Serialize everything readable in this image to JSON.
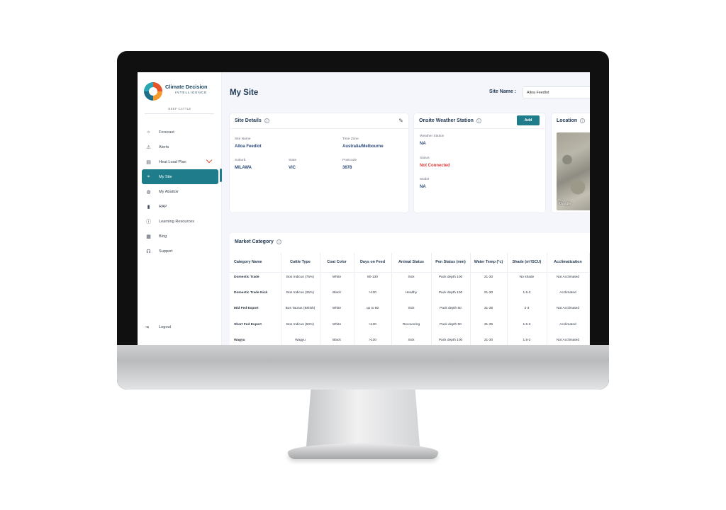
{
  "app": {
    "brand_line1": "Climate Decision",
    "brand_line2": "INTELLIGENCE",
    "org": "BEEF CATTLE"
  },
  "sidebar": {
    "items": [
      {
        "label": "Forecast",
        "icon": "sun-icon"
      },
      {
        "label": "Alerts",
        "icon": "warning-icon"
      },
      {
        "label": "Heat Load Plan",
        "icon": "plan-icon"
      },
      {
        "label": "My Site",
        "icon": "site-icon"
      },
      {
        "label": "My Abattoir",
        "icon": "abattoir-icon"
      },
      {
        "label": "RAP",
        "icon": "bar-chart-icon"
      },
      {
        "label": "Learning Resources",
        "icon": "info-icon"
      },
      {
        "label": "Blog",
        "icon": "blog-icon"
      },
      {
        "label": "Support",
        "icon": "headset-icon"
      }
    ],
    "logout": "Logout"
  },
  "header": {
    "title": "My Site",
    "site_name_label": "Site Name :",
    "site_name_value": "Alloa Feedlot"
  },
  "site_details": {
    "title": "Site Details",
    "site_name_label": "Site Name",
    "site_name": "Alloa Feedlot",
    "time_zone_label": "Time Zone",
    "time_zone": "Australia/Melbourne",
    "suburb_label": "Suburb",
    "suburb": "MILAWA",
    "state_label": "State",
    "state": "VIC",
    "postcode_label": "Postcode",
    "postcode": "3678"
  },
  "weather_station": {
    "title": "Onsite Weather Station",
    "add_label": "Add",
    "station_label": "Weather Station",
    "station": "NA",
    "status_label": "Status",
    "status": "Not Connected",
    "model_label": "Model",
    "model": "NA"
  },
  "location": {
    "title": "Location",
    "map_label": "Google"
  },
  "market": {
    "title": "Market Category",
    "headers": [
      "Category Name",
      "Cattle Type",
      "Coat Color",
      "Days on Feed",
      "Animal Status",
      "Pen Status (mm)",
      "Water Temp (°c)",
      "Shade (m²/SCU)",
      "Acclimatization"
    ],
    "rows": [
      [
        "Domestic Trade",
        "Bos Indicus (75%)",
        "White",
        "80-130",
        "Sick",
        "Pack depth 100",
        "21-30",
        "No shade",
        "Not Acclimated"
      ],
      [
        "Domestic Trade Nick",
        "Bos Indicus (25%)",
        "Black",
        ">130",
        "Healthy",
        "Pack depth 100",
        "21-30",
        "1.5-2",
        "Acclimated"
      ],
      [
        "Mid Fed Export",
        "Bos Taurus (British)",
        "White",
        "up to 80",
        "Sick",
        "Pack depth 50",
        "31-35",
        "2-3",
        "Not Acclimated"
      ],
      [
        "Short Fed Export",
        "Bos Indicus (50%)",
        "White",
        ">130",
        "Recovering",
        "Pack depth 50",
        "31-35",
        "1.5-2",
        "Acclimated"
      ],
      [
        "Wagyu",
        "Wagyu",
        "Black",
        ">130",
        "Sick",
        "Pack depth 100",
        "21-30",
        "1.5-2",
        "Not Acclimated"
      ]
    ]
  },
  "colors": {
    "accent": "#1f7c8a",
    "title": "#243b55",
    "danger": "#e03b3b"
  }
}
